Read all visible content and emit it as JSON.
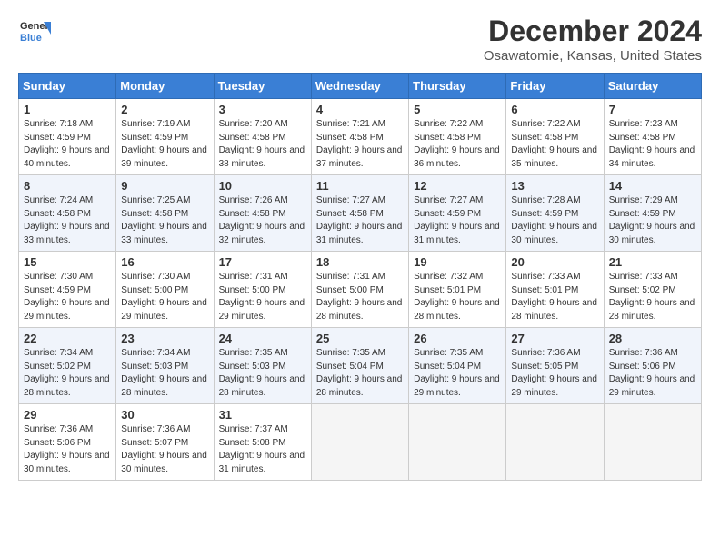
{
  "app": {
    "name": "GeneralBlue",
    "logo_label": "General Blue"
  },
  "header": {
    "month": "December 2024",
    "location": "Osawatomie, Kansas, United States"
  },
  "columns": [
    "Sunday",
    "Monday",
    "Tuesday",
    "Wednesday",
    "Thursday",
    "Friday",
    "Saturday"
  ],
  "weeks": [
    [
      {
        "day": "1",
        "sunrise": "Sunrise: 7:18 AM",
        "sunset": "Sunset: 4:59 PM",
        "daylight": "Daylight: 9 hours and 40 minutes."
      },
      {
        "day": "2",
        "sunrise": "Sunrise: 7:19 AM",
        "sunset": "Sunset: 4:59 PM",
        "daylight": "Daylight: 9 hours and 39 minutes."
      },
      {
        "day": "3",
        "sunrise": "Sunrise: 7:20 AM",
        "sunset": "Sunset: 4:58 PM",
        "daylight": "Daylight: 9 hours and 38 minutes."
      },
      {
        "day": "4",
        "sunrise": "Sunrise: 7:21 AM",
        "sunset": "Sunset: 4:58 PM",
        "daylight": "Daylight: 9 hours and 37 minutes."
      },
      {
        "day": "5",
        "sunrise": "Sunrise: 7:22 AM",
        "sunset": "Sunset: 4:58 PM",
        "daylight": "Daylight: 9 hours and 36 minutes."
      },
      {
        "day": "6",
        "sunrise": "Sunrise: 7:22 AM",
        "sunset": "Sunset: 4:58 PM",
        "daylight": "Daylight: 9 hours and 35 minutes."
      },
      {
        "day": "7",
        "sunrise": "Sunrise: 7:23 AM",
        "sunset": "Sunset: 4:58 PM",
        "daylight": "Daylight: 9 hours and 34 minutes."
      }
    ],
    [
      {
        "day": "8",
        "sunrise": "Sunrise: 7:24 AM",
        "sunset": "Sunset: 4:58 PM",
        "daylight": "Daylight: 9 hours and 33 minutes."
      },
      {
        "day": "9",
        "sunrise": "Sunrise: 7:25 AM",
        "sunset": "Sunset: 4:58 PM",
        "daylight": "Daylight: 9 hours and 33 minutes."
      },
      {
        "day": "10",
        "sunrise": "Sunrise: 7:26 AM",
        "sunset": "Sunset: 4:58 PM",
        "daylight": "Daylight: 9 hours and 32 minutes."
      },
      {
        "day": "11",
        "sunrise": "Sunrise: 7:27 AM",
        "sunset": "Sunset: 4:58 PM",
        "daylight": "Daylight: 9 hours and 31 minutes."
      },
      {
        "day": "12",
        "sunrise": "Sunrise: 7:27 AM",
        "sunset": "Sunset: 4:59 PM",
        "daylight": "Daylight: 9 hours and 31 minutes."
      },
      {
        "day": "13",
        "sunrise": "Sunrise: 7:28 AM",
        "sunset": "Sunset: 4:59 PM",
        "daylight": "Daylight: 9 hours and 30 minutes."
      },
      {
        "day": "14",
        "sunrise": "Sunrise: 7:29 AM",
        "sunset": "Sunset: 4:59 PM",
        "daylight": "Daylight: 9 hours and 30 minutes."
      }
    ],
    [
      {
        "day": "15",
        "sunrise": "Sunrise: 7:30 AM",
        "sunset": "Sunset: 4:59 PM",
        "daylight": "Daylight: 9 hours and 29 minutes."
      },
      {
        "day": "16",
        "sunrise": "Sunrise: 7:30 AM",
        "sunset": "Sunset: 5:00 PM",
        "daylight": "Daylight: 9 hours and 29 minutes."
      },
      {
        "day": "17",
        "sunrise": "Sunrise: 7:31 AM",
        "sunset": "Sunset: 5:00 PM",
        "daylight": "Daylight: 9 hours and 29 minutes."
      },
      {
        "day": "18",
        "sunrise": "Sunrise: 7:31 AM",
        "sunset": "Sunset: 5:00 PM",
        "daylight": "Daylight: 9 hours and 28 minutes."
      },
      {
        "day": "19",
        "sunrise": "Sunrise: 7:32 AM",
        "sunset": "Sunset: 5:01 PM",
        "daylight": "Daylight: 9 hours and 28 minutes."
      },
      {
        "day": "20",
        "sunrise": "Sunrise: 7:33 AM",
        "sunset": "Sunset: 5:01 PM",
        "daylight": "Daylight: 9 hours and 28 minutes."
      },
      {
        "day": "21",
        "sunrise": "Sunrise: 7:33 AM",
        "sunset": "Sunset: 5:02 PM",
        "daylight": "Daylight: 9 hours and 28 minutes."
      }
    ],
    [
      {
        "day": "22",
        "sunrise": "Sunrise: 7:34 AM",
        "sunset": "Sunset: 5:02 PM",
        "daylight": "Daylight: 9 hours and 28 minutes."
      },
      {
        "day": "23",
        "sunrise": "Sunrise: 7:34 AM",
        "sunset": "Sunset: 5:03 PM",
        "daylight": "Daylight: 9 hours and 28 minutes."
      },
      {
        "day": "24",
        "sunrise": "Sunrise: 7:35 AM",
        "sunset": "Sunset: 5:03 PM",
        "daylight": "Daylight: 9 hours and 28 minutes."
      },
      {
        "day": "25",
        "sunrise": "Sunrise: 7:35 AM",
        "sunset": "Sunset: 5:04 PM",
        "daylight": "Daylight: 9 hours and 28 minutes."
      },
      {
        "day": "26",
        "sunrise": "Sunrise: 7:35 AM",
        "sunset": "Sunset: 5:04 PM",
        "daylight": "Daylight: 9 hours and 29 minutes."
      },
      {
        "day": "27",
        "sunrise": "Sunrise: 7:36 AM",
        "sunset": "Sunset: 5:05 PM",
        "daylight": "Daylight: 9 hours and 29 minutes."
      },
      {
        "day": "28",
        "sunrise": "Sunrise: 7:36 AM",
        "sunset": "Sunset: 5:06 PM",
        "daylight": "Daylight: 9 hours and 29 minutes."
      }
    ],
    [
      {
        "day": "29",
        "sunrise": "Sunrise: 7:36 AM",
        "sunset": "Sunset: 5:06 PM",
        "daylight": "Daylight: 9 hours and 30 minutes."
      },
      {
        "day": "30",
        "sunrise": "Sunrise: 7:36 AM",
        "sunset": "Sunset: 5:07 PM",
        "daylight": "Daylight: 9 hours and 30 minutes."
      },
      {
        "day": "31",
        "sunrise": "Sunrise: 7:37 AM",
        "sunset": "Sunset: 5:08 PM",
        "daylight": "Daylight: 9 hours and 31 minutes."
      },
      null,
      null,
      null,
      null
    ]
  ]
}
